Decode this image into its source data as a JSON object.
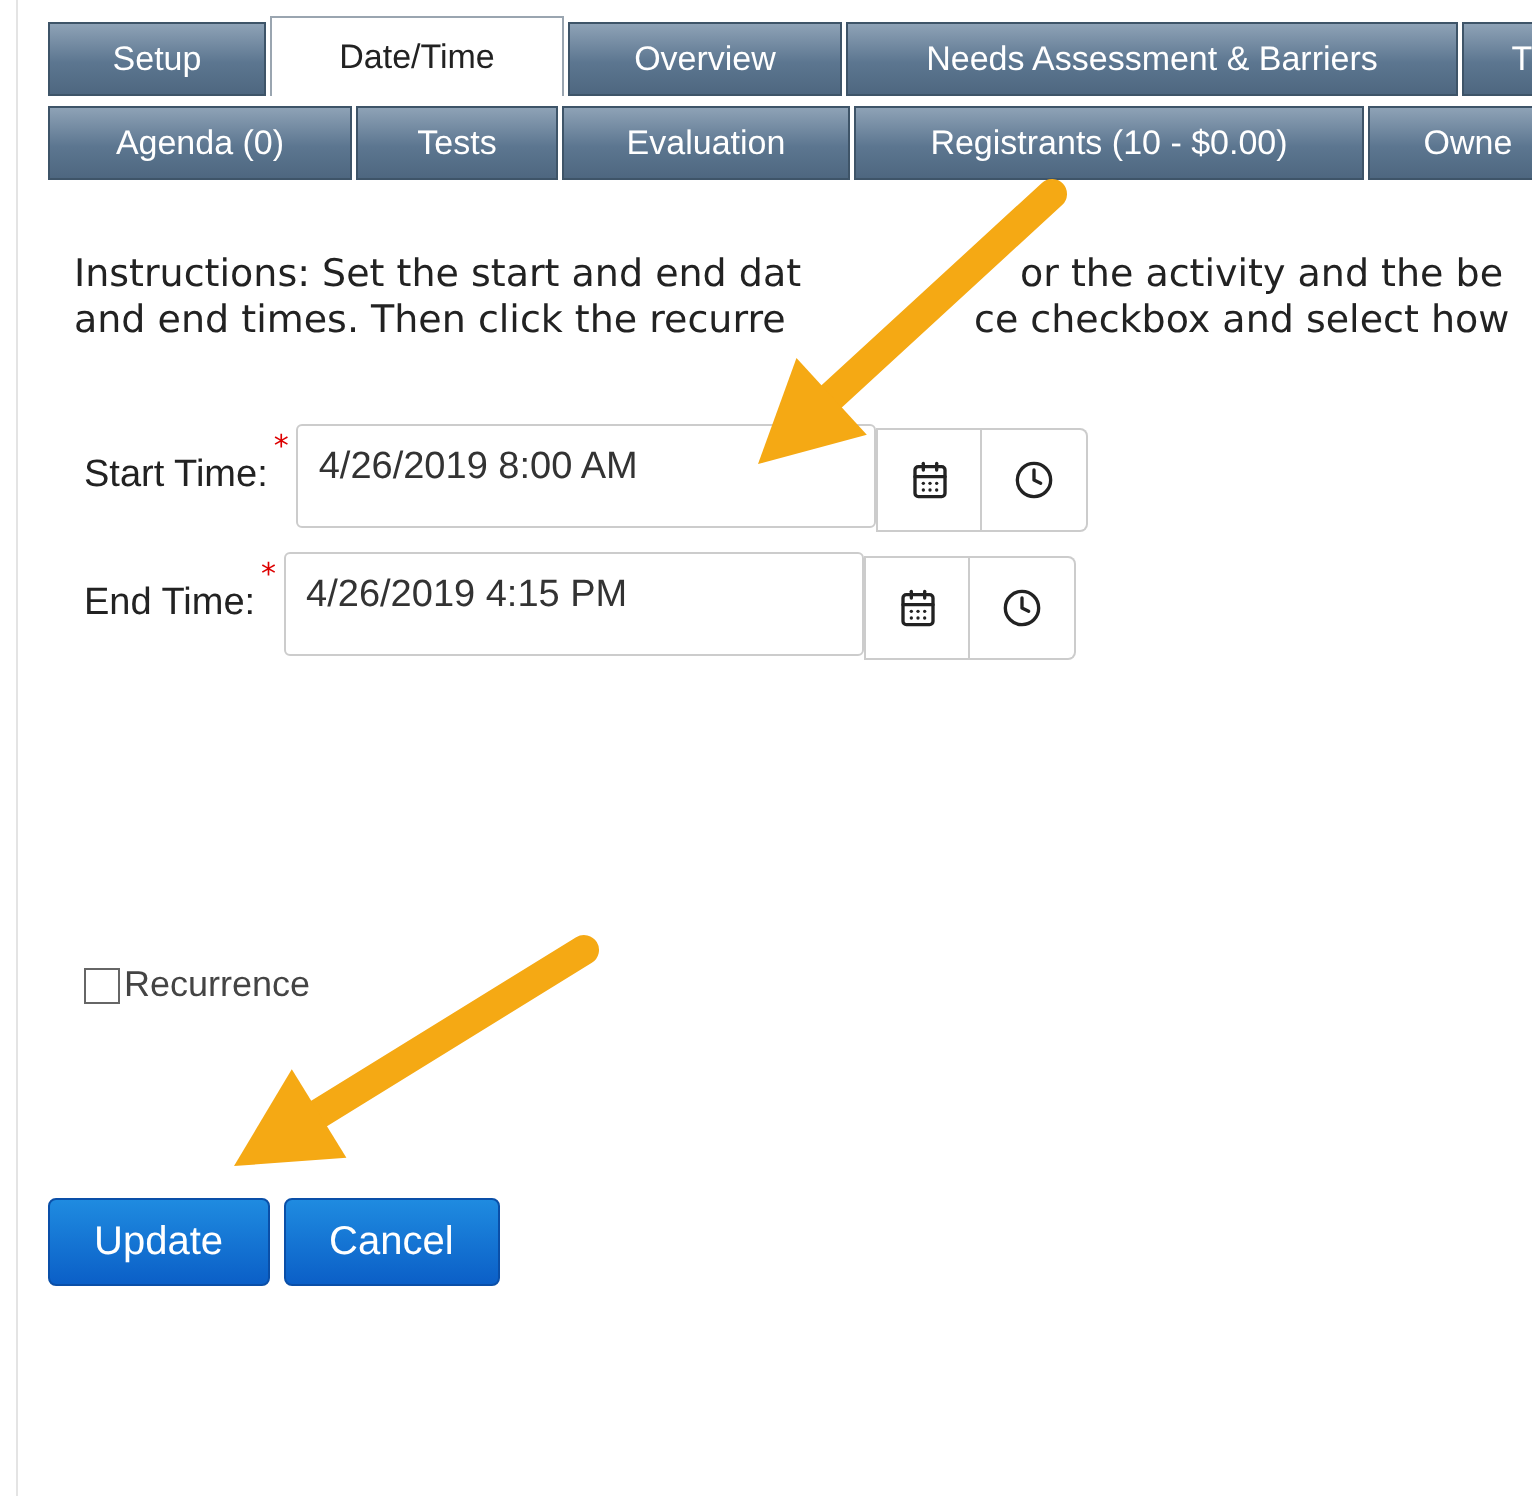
{
  "tab_rows": [
    {
      "tabs": [
        {
          "label": "Setup",
          "selected": false
        },
        {
          "label": "Date/Time",
          "selected": true
        },
        {
          "label": "Overview",
          "selected": false
        },
        {
          "label": "Needs Assessment & Barriers",
          "selected": false
        },
        {
          "label": "T",
          "selected": false
        }
      ]
    },
    {
      "tabs": [
        {
          "label": "Agenda (0)",
          "selected": false
        },
        {
          "label": "Tests",
          "selected": false
        },
        {
          "label": "Evaluation",
          "selected": false
        },
        {
          "label": "Registrants (10 - $0.00)",
          "selected": false
        },
        {
          "label": "Owne",
          "selected": false
        }
      ]
    }
  ],
  "instructions": [
    [
      "Instructions: Set the start and end dat",
      "or the activity and the be"
    ],
    [
      "and end times. Then click the recurre",
      "ce checkbox and select how"
    ]
  ],
  "fields": [
    {
      "label": "Start Time:",
      "required_mark": "*",
      "value": "4/26/2019 8:00 AM"
    },
    {
      "label": "End Time:",
      "required_mark": "*",
      "value": "4/26/2019 4:15 PM"
    }
  ],
  "recurrence": {
    "label": "Recurrence",
    "checked": false
  },
  "buttons": [
    "Update",
    "Cancel"
  ]
}
